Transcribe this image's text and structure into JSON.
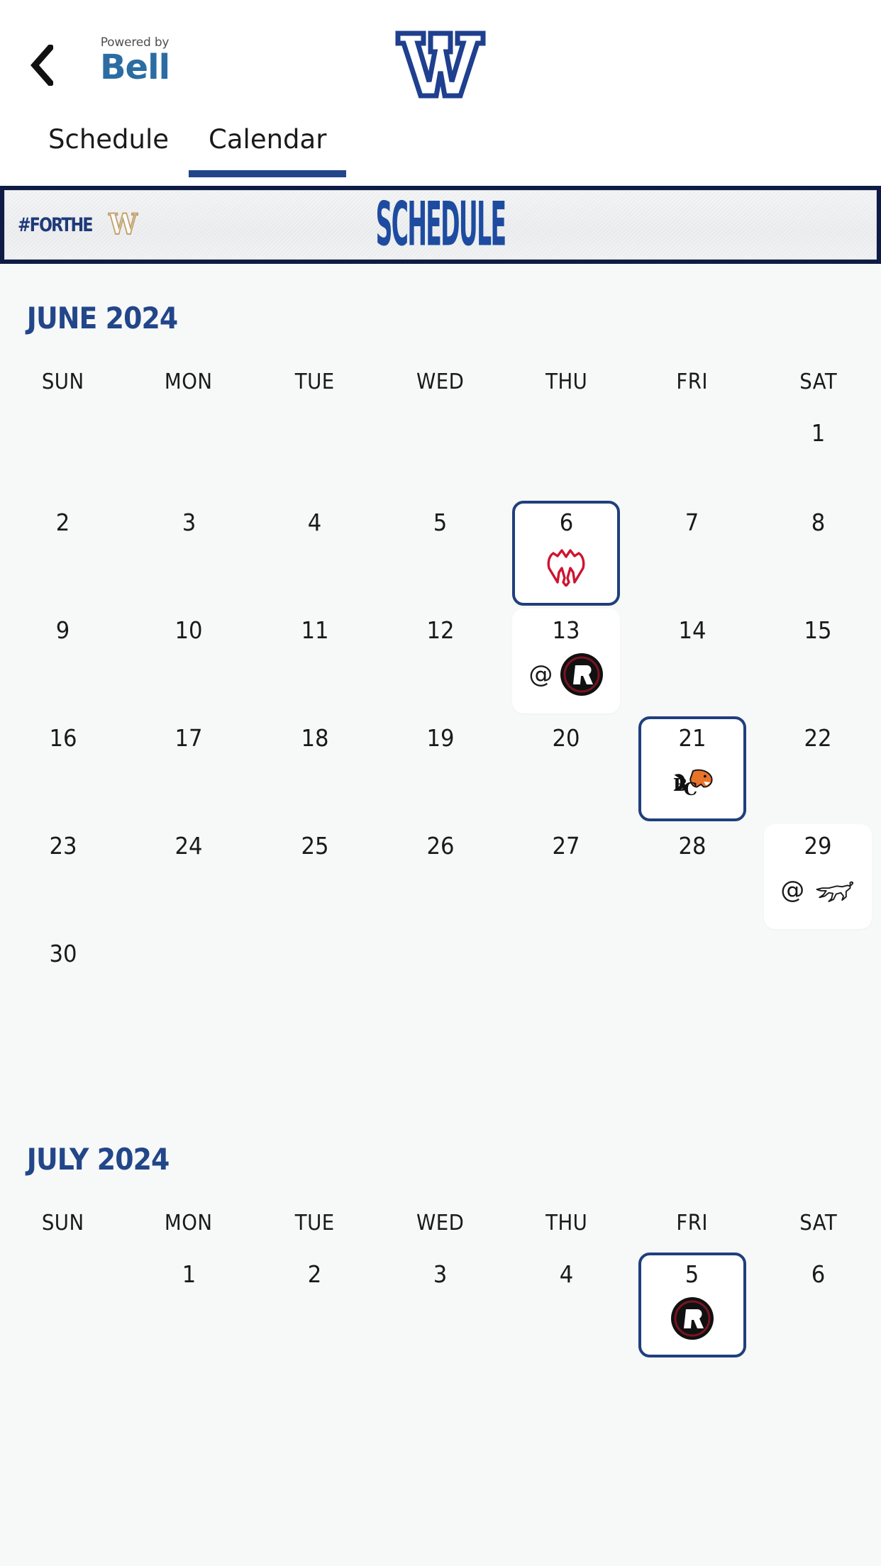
{
  "header": {
    "back_icon": "chevron-left-icon",
    "sponsor": {
      "powered_by": "Powered by",
      "brand": "Bell",
      "brand_color": "#2b6ca3"
    },
    "team_logo_name": "winnipeg-blue-bombers-w-logo",
    "team_logo_color": "#1f3f8f"
  },
  "tabs": [
    {
      "label": "Schedule",
      "active": false
    },
    {
      "label": "Calendar",
      "active": true
    }
  ],
  "banner": {
    "hashtag_text": "#FORTHE",
    "hashtag_w": "W",
    "title": "SCHEDULE",
    "frame_color": "#0d1b45",
    "title_color": "#1d4ba0"
  },
  "colors": {
    "accent_navy": "#22468a",
    "home_border": "#1f3f7d",
    "page_bg": "#f7f8f8",
    "month_title": "#22468a"
  },
  "day_labels": [
    "SUN",
    "MON",
    "TUE",
    "WED",
    "THU",
    "FRI",
    "SAT"
  ],
  "months": [
    {
      "title": "JUNE 2024",
      "weeks": [
        [
          {
            "day": ""
          },
          {
            "day": ""
          },
          {
            "day": ""
          },
          {
            "day": ""
          },
          {
            "day": ""
          },
          {
            "day": ""
          },
          {
            "day": "1"
          }
        ],
        [
          {
            "day": "2"
          },
          {
            "day": "3"
          },
          {
            "day": "4"
          },
          {
            "day": "5"
          },
          {
            "day": "6",
            "game": {
              "type": "home",
              "at": "",
              "opponent": "Montreal Alouettes",
              "logo": "montreal-alouettes-logo"
            }
          },
          {
            "day": "7"
          },
          {
            "day": "8"
          }
        ],
        [
          {
            "day": "9"
          },
          {
            "day": "10"
          },
          {
            "day": "11"
          },
          {
            "day": "12"
          },
          {
            "day": "13",
            "game": {
              "type": "away",
              "at": "@",
              "opponent": "Ottawa Redblacks",
              "logo": "ottawa-redblacks-logo"
            }
          },
          {
            "day": "14"
          },
          {
            "day": "15"
          }
        ],
        [
          {
            "day": "16"
          },
          {
            "day": "17"
          },
          {
            "day": "18"
          },
          {
            "day": "19"
          },
          {
            "day": "20"
          },
          {
            "day": "21",
            "game": {
              "type": "home",
              "at": "",
              "opponent": "BC Lions",
              "logo": "bc-lions-logo"
            }
          },
          {
            "day": "22"
          }
        ],
        [
          {
            "day": "23"
          },
          {
            "day": "24"
          },
          {
            "day": "25"
          },
          {
            "day": "26"
          },
          {
            "day": "27"
          },
          {
            "day": "28"
          },
          {
            "day": "29",
            "game": {
              "type": "away",
              "at": "@",
              "opponent": "Calgary Stampeders",
              "logo": "calgary-stampeders-logo"
            }
          }
        ],
        [
          {
            "day": "30"
          },
          {
            "day": ""
          },
          {
            "day": ""
          },
          {
            "day": ""
          },
          {
            "day": ""
          },
          {
            "day": ""
          },
          {
            "day": ""
          }
        ]
      ]
    },
    {
      "title": "JULY 2024",
      "weeks": [
        [
          {
            "day": ""
          },
          {
            "day": "1"
          },
          {
            "day": "2"
          },
          {
            "day": "3"
          },
          {
            "day": "4"
          },
          {
            "day": "5",
            "game": {
              "type": "home",
              "at": "",
              "opponent": "Ottawa Redblacks",
              "logo": "ottawa-redblacks-logo"
            }
          },
          {
            "day": "6"
          }
        ]
      ]
    }
  ]
}
